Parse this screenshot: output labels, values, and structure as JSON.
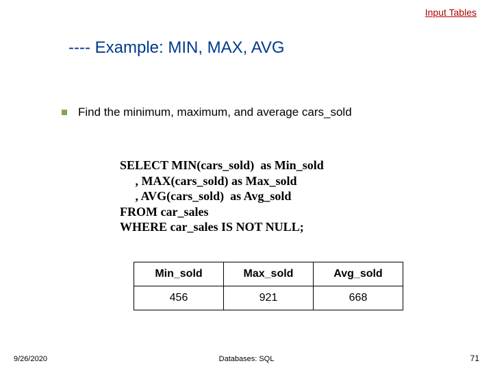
{
  "top_link": "Input Tables",
  "title": "---- Example: MIN, MAX, AVG",
  "bullet": "Find the minimum, maximum, and average cars_sold",
  "sql": {
    "l1": "SELECT MIN(cars_sold)  as Min_sold",
    "l2": "     , MAX(cars_sold) as Max_sold",
    "l3": "     , AVG(cars_sold)  as Avg_sold",
    "l4": "FROM car_sales",
    "l5": "WHERE car_sales IS NOT NULL;"
  },
  "table": {
    "headers": {
      "c1": "Min_sold",
      "c2": "Max_sold",
      "c3": "Avg_sold"
    },
    "row": {
      "c1": "456",
      "c2": "921",
      "c3": "668"
    }
  },
  "footer": {
    "date": "9/26/2020",
    "center": "Databases: SQL",
    "page": "71"
  },
  "chart_data": {
    "type": "table",
    "title": "Example: MIN, MAX, AVG",
    "headers": [
      "Min_sold",
      "Max_sold",
      "Avg_sold"
    ],
    "rows": [
      [
        456,
        921,
        668
      ]
    ]
  }
}
